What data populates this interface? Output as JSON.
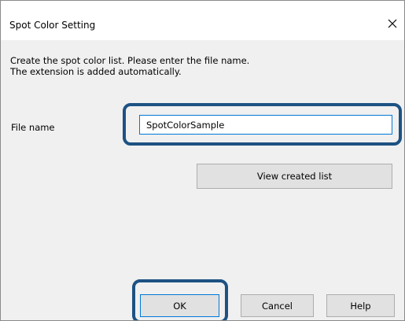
{
  "window": {
    "title": "Spot Color Setting",
    "close_icon": "close-icon"
  },
  "description": {
    "line1": "Create the spot color list. Please enter the file name.",
    "line2": "The extension is added automatically."
  },
  "file_name": {
    "label": "File name",
    "value": "SpotColorSample"
  },
  "buttons": {
    "view_created_list": "View created list",
    "ok": "OK",
    "cancel": "Cancel",
    "help": "Help"
  },
  "colors": {
    "highlight": "#1d5283",
    "focus_blue": "#0078d7",
    "button_face": "#e1e1e1",
    "client_bg": "#f0f0f0"
  }
}
